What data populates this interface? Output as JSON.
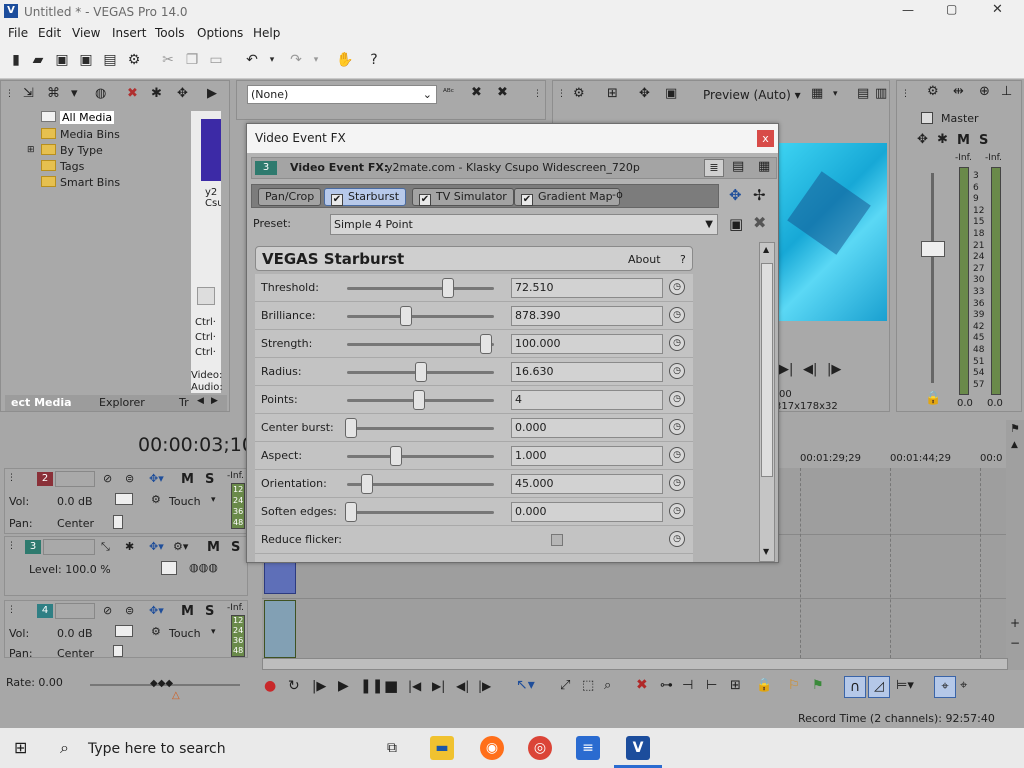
{
  "window": {
    "title": "Untitled * - VEGAS Pro 14.0",
    "min": "—",
    "max": "▢",
    "close": "✕"
  },
  "menu": [
    "File",
    "Edit",
    "View",
    "Insert",
    "Tools",
    "Options",
    "Help"
  ],
  "explorer": {
    "tree": [
      "All Media",
      "Media Bins",
      "By Type",
      "Tags",
      "Smart Bins"
    ],
    "tabs": [
      "ect Media",
      "Explorer",
      "Tr"
    ],
    "thumb_label": "y2\nCsu",
    "info": [
      "Ctrl·",
      "Ctrl·",
      "Ctrl·",
      "Video:",
      "Audio:"
    ]
  },
  "fx_dropdown": "(None)",
  "preview": {
    "label": "Preview (Auto)",
    "frame_info": "00",
    "res": "317x178x32"
  },
  "master": {
    "label": "Master",
    "inf_l": "-Inf.",
    "inf_r": "-Inf.",
    "scale": [
      "3",
      "6",
      "9",
      "12",
      "15",
      "18",
      "21",
      "24",
      "27",
      "30",
      "33",
      "36",
      "39",
      "42",
      "45",
      "48",
      "51",
      "54",
      "57"
    ],
    "val_l": "0.0",
    "val_r": "0.0"
  },
  "timecode": "00:00:03;10",
  "ruler": [
    "00:01:29;29",
    "00:01:44;29",
    "00:0"
  ],
  "tracks": [
    {
      "num": "2",
      "vol": "Vol:",
      "vol_val": "0.0 dB",
      "pan": "Pan:",
      "pan_val": "Center",
      "mode": "Touch",
      "inf": "-Inf."
    },
    {
      "num": "3",
      "level": "Level: 100.0 %"
    },
    {
      "num": "4",
      "vol": "Vol:",
      "vol_val": "0.0 dB",
      "pan": "Pan:",
      "pan_val": "Center",
      "mode": "Touch",
      "inf": "-Inf."
    }
  ],
  "mini_scale": [
    "12",
    "24",
    "36",
    "48"
  ],
  "rate": "Rate: 0.00",
  "status": "Record Time (2 channels): 92:57:40",
  "dialog": {
    "title": "Video Event FX",
    "close": "x",
    "track_num": "3",
    "fx_label": "Video Event FX:",
    "fx_source": "y2mate.com - Klasky Csupo Widescreen_720p",
    "chain": [
      "Pan/Crop",
      "Starburst",
      "TV Simulator",
      "Gradient Map"
    ],
    "preset_label": "Preset:",
    "preset_value": "Simple 4 Point",
    "plugin_name": "VEGAS Starburst",
    "about": "About",
    "help": "?",
    "params": [
      {
        "label": "Threshold:",
        "value": "72.510",
        "pos": 0.72
      },
      {
        "label": "Brilliance:",
        "value": "878.390",
        "pos": 0.41
      },
      {
        "label": "Strength:",
        "value": "100.000",
        "pos": 1.0
      },
      {
        "label": "Radius:",
        "value": "16.630",
        "pos": 0.52
      },
      {
        "label": "Points:",
        "value": "4",
        "pos": 0.5
      },
      {
        "label": "Center burst:",
        "value": "0.000",
        "pos": 0.0
      },
      {
        "label": "Aspect:",
        "value": "1.000",
        "pos": 0.33
      },
      {
        "label": "Orientation:",
        "value": "45.000",
        "pos": 0.12
      },
      {
        "label": "Soften edges:",
        "value": "0.000",
        "pos": 0.0
      }
    ],
    "reduce_flicker": "Reduce flicker:"
  },
  "taskbar": {
    "search": "Type here to search"
  }
}
